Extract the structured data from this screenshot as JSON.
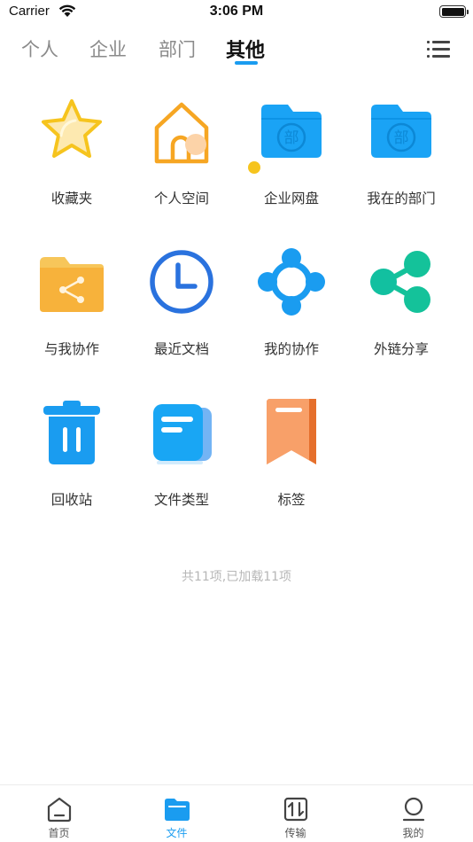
{
  "status_bar": {
    "carrier": "Carrier",
    "time": "3:06 PM"
  },
  "tabs": [
    {
      "label": "个人",
      "active": false
    },
    {
      "label": "企业",
      "active": false
    },
    {
      "label": "部门",
      "active": false
    },
    {
      "label": "其他",
      "active": true
    }
  ],
  "menu_icon": "list-menu-icon",
  "items": [
    {
      "label": "收藏夹",
      "icon": "star-icon"
    },
    {
      "label": "个人空间",
      "icon": "house-icon"
    },
    {
      "label": "企业网盘",
      "icon": "enterprise-folder-icon"
    },
    {
      "label": "我在的部门",
      "icon": "department-folder-icon"
    },
    {
      "label": "与我协作",
      "icon": "shared-folder-icon"
    },
    {
      "label": "最近文档",
      "icon": "clock-icon"
    },
    {
      "label": "我的协作",
      "icon": "collaboration-icon"
    },
    {
      "label": "外链分享",
      "icon": "share-icon"
    },
    {
      "label": "回收站",
      "icon": "trash-icon"
    },
    {
      "label": "文件类型",
      "icon": "file-type-icon"
    },
    {
      "label": "标签",
      "icon": "bookmark-tag-icon"
    }
  ],
  "footer": {
    "count_text": "共11项,已加载11项"
  },
  "bottom_nav": [
    {
      "label": "首页",
      "icon": "home-icon",
      "active": false
    },
    {
      "label": "文件",
      "icon": "folder-icon",
      "active": true
    },
    {
      "label": "传输",
      "icon": "transfer-icon",
      "active": false
    },
    {
      "label": "我的",
      "icon": "profile-icon",
      "active": false
    }
  ],
  "colors": {
    "accent": "#1a9cf0",
    "tab_inactive": "#8a8a8a",
    "footer_text": "#b7b7b7"
  }
}
